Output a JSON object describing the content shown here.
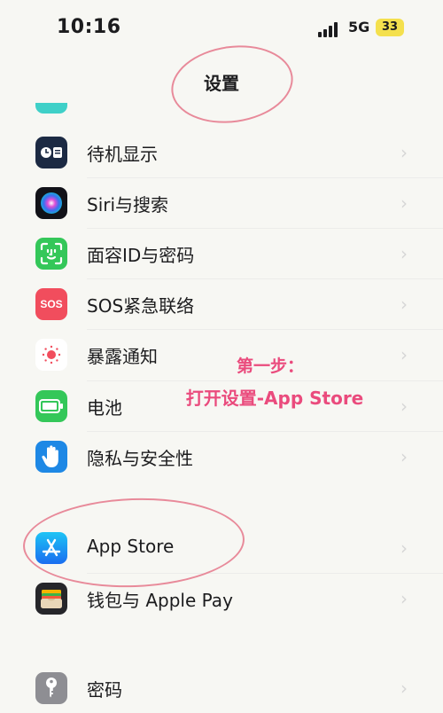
{
  "status_bar": {
    "time": "10:16",
    "network": "5G",
    "battery": "33"
  },
  "header": {
    "title": "设置"
  },
  "rows": [
    {
      "id": "standby",
      "label": "待机显示",
      "icon": "standby-display-icon",
      "color": "#1c2a43"
    },
    {
      "id": "siri",
      "label": "Siri与搜索",
      "icon": "siri-icon",
      "color": "#3b2a8a"
    },
    {
      "id": "faceid",
      "label": "面容ID与密码",
      "icon": "face-id-icon",
      "color": "#34c759"
    },
    {
      "id": "sos",
      "label": "SOS紧急联络",
      "icon": "sos-icon",
      "color": "#f14d5d"
    },
    {
      "id": "exposure",
      "label": "暴露通知",
      "icon": "exposure-icon",
      "color": "#ffffff"
    },
    {
      "id": "battery",
      "label": "电池",
      "icon": "battery-icon",
      "color": "#34c759"
    },
    {
      "id": "privacy",
      "label": "隐私与安全性",
      "icon": "hand-icon",
      "color": "#1e88e5"
    },
    {
      "id": "appstore",
      "label": "App Store",
      "icon": "app-store-icon",
      "color": "#1a8cf0"
    },
    {
      "id": "wallet",
      "label": "钱包与 Apple Pay",
      "icon": "wallet-icon",
      "color": "#26262a"
    },
    {
      "id": "passwords",
      "label": "密码",
      "icon": "key-icon",
      "color": "#8e8e93"
    }
  ],
  "annotation": {
    "line1": "第一步：",
    "line2": "打开设置-App Store",
    "color": "#ea4b7d"
  }
}
